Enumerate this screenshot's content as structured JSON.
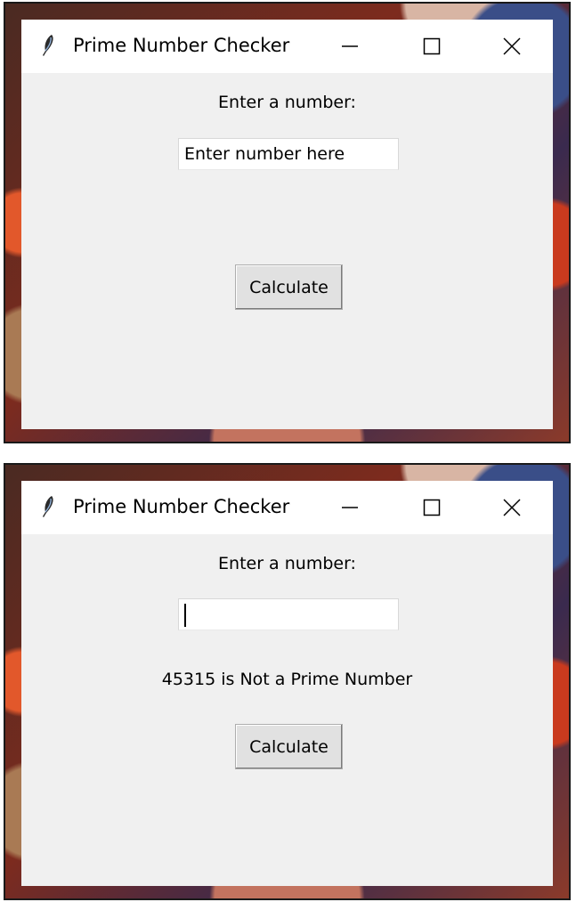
{
  "windows": [
    {
      "title": "Prime Number Checker",
      "prompt_label": "Enter a number:",
      "entry": {
        "value": "Enter number here",
        "focused": false
      },
      "result": "",
      "button_label": "Calculate"
    },
    {
      "title": "Prime Number Checker",
      "prompt_label": "Enter a number:",
      "entry": {
        "value": "",
        "focused": true
      },
      "result": "45315 is Not a Prime Number",
      "button_label": "Calculate"
    }
  ],
  "icons": {
    "app": "tk-feather-icon",
    "minimize": "minimize-icon",
    "maximize": "maximize-icon",
    "close": "close-icon"
  }
}
